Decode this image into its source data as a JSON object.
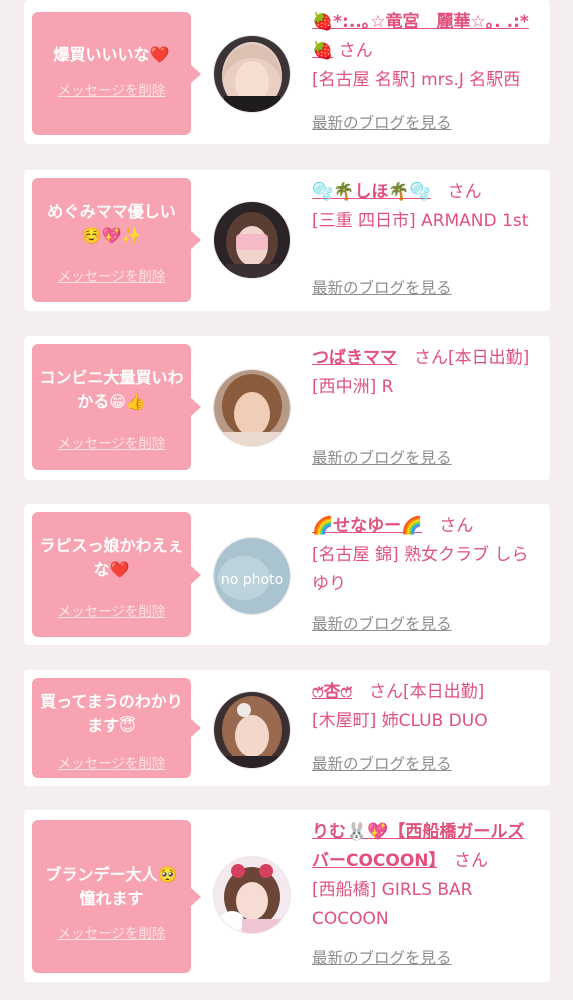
{
  "items": [
    {
      "message": "爆買いいいな❤️",
      "delete_label": "メッセージを削除",
      "name": "🍓*:..｡☆竜宮　麗華☆｡. .:*🍓",
      "suffix": "さん",
      "shop": "[名古屋 名駅] mrs.J 名駅西",
      "blog_label": "最新のブログを見る",
      "avatar_icon": "profile-photo"
    },
    {
      "message": "めぐみママ優しい☺️💖✨",
      "delete_label": "メッセージを削除",
      "name": "🫧🌴しほ🌴🫧",
      "suffix": "さん",
      "shop": "[三重 四日市] ARMAND 1st",
      "blog_label": "最新のブログを見る",
      "avatar_icon": "profile-photo"
    },
    {
      "message": "コンビニ大量買いわかる😁👍",
      "delete_label": "メッセージを削除",
      "name": "つばきママ",
      "suffix": "さん[本日出勤]",
      "shop": "[西中洲] R",
      "blog_label": "最新のブログを見る",
      "avatar_icon": "profile-photo"
    },
    {
      "message": "ラピスっ娘かわえぇな❤️",
      "delete_label": "メッセージを削除",
      "name": "🌈せなゆー🌈",
      "suffix": "さん",
      "shop": "[名古屋 錦] 熟女クラブ しらゆり",
      "blog_label": "最新のブログを見る",
      "avatar_icon": "no-photo",
      "avatar_text": "no photo"
    },
    {
      "message": "買ってまうのわかります😇",
      "delete_label": "メッセージを削除",
      "name": "ෆ̈杏ෆ̈",
      "suffix": "さん[本日出勤]",
      "shop": "[木屋町] 姉CLUB DUO",
      "blog_label": "最新のブログを見る",
      "avatar_icon": "profile-photo"
    },
    {
      "message": "ブランデー大人🥺憧れます",
      "delete_label": "メッセージを削除",
      "name": "りむ🐰💖【西船橋ガールズバーCOCOON】",
      "suffix": "さん",
      "shop": "[西船橋] GIRLS BAR COCOON",
      "blog_label": "最新のブログを見る",
      "avatar_icon": "profile-photo"
    }
  ],
  "colors": {
    "accent_pink": "#e0527d",
    "bubble_pink": "#f8a3b1",
    "muted_gray": "#8d8d8d",
    "page_bg": "#f4eef0"
  }
}
